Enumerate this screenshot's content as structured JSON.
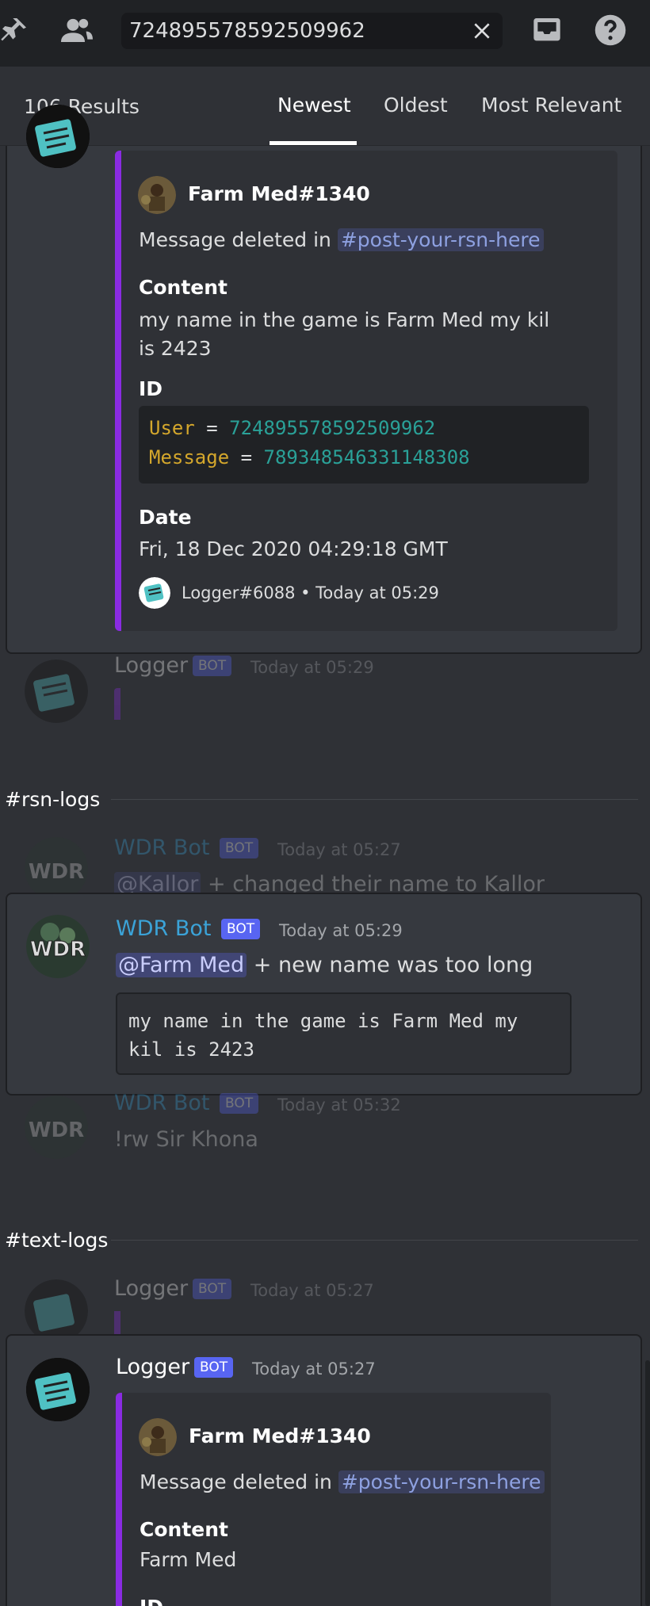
{
  "search": {
    "value": "724895578592509962"
  },
  "results": {
    "count": "106 Results",
    "tabs": [
      "Newest",
      "Oldest",
      "Most Relevant"
    ]
  },
  "card1": {
    "embed_author": "Farm Med#1340",
    "deleted_prefix": "Message deleted in",
    "channel": "#post-your-rsn-here",
    "content_label": "Content",
    "content": "my name in the game is Farm Med my kil is 2423",
    "id_label": "ID",
    "code_user_key": "User",
    "code_user_val": "724895578592509962",
    "code_msg_key": "Message",
    "code_msg_val": "789348546331148308",
    "eq": "=",
    "date_label": "Date",
    "date": "Fri, 18 Dec 2020 04:29:18 GMT",
    "footer": "Logger#6088 • Today at 05:29"
  },
  "ctx1": {
    "username": "Logger",
    "badge": "BOT",
    "time": "Today at 05:29"
  },
  "section1": "#rsn-logs",
  "ctx2": {
    "username": "WDR Bot",
    "badge": "BOT",
    "time": "Today at 05:27",
    "mention": "@Kallor",
    "text": "+ changed their name to Kallor"
  },
  "card2": {
    "username": "WDR Bot",
    "badge": "BOT",
    "time": "Today at 05:29",
    "mention": "@Farm Med",
    "text": "+ new name was too long",
    "code": "my name in the game is Farm Med my kil is 2423"
  },
  "ctx3": {
    "username": "WDR Bot",
    "badge": "BOT",
    "time": "Today at 05:32",
    "text": "!rw Sir Khona"
  },
  "section2": "#text-logs",
  "ctx4": {
    "username": "Logger",
    "badge": "BOT",
    "time": "Today at 05:27"
  },
  "card3": {
    "username": "Logger",
    "badge": "BOT",
    "time": "Today at 05:27",
    "embed_author": "Farm Med#1340",
    "deleted_prefix": "Message deleted in",
    "channel": "#post-your-rsn-here",
    "content_label": "Content",
    "content": "Farm Med",
    "id_label": "ID"
  },
  "colors": {
    "embed_bar": "#8a2be2",
    "bot_badge": "#5865f2",
    "wdr_name": "#3ba3d8",
    "channel_link": "#8ea1e1"
  }
}
